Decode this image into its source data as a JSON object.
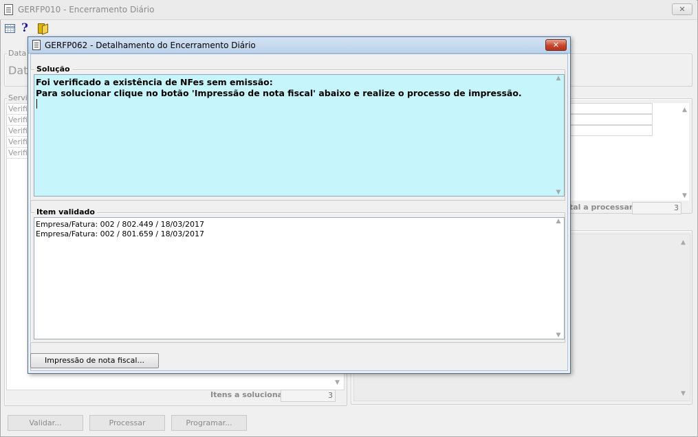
{
  "main_window": {
    "title": "GERFP010 - Encerramento Diário",
    "close_symbol": "✕",
    "toolbar": {
      "grid_icon": "grid-icon",
      "help_icon": "?",
      "exit_icon": "door-exit-icon"
    },
    "data_group": {
      "title": "Data",
      "big_label": "Data"
    },
    "servicos_group": {
      "title": "Servi",
      "rows": [
        "Verific",
        "Verific",
        "Verific",
        "Verific",
        "Verific"
      ]
    },
    "total_label": "tal a processar",
    "total_value": "3",
    "itens_solucionar_label": "Itens a solucionar",
    "itens_solucionar_value": "3",
    "buttons": {
      "validar": "Validar...",
      "processar": "Processar",
      "programar": "Programar..."
    }
  },
  "dialog": {
    "title": "GERFP062 - Detalhamento do Encerramento Diário",
    "close_symbol": "✕",
    "solucao": {
      "title": "Solução",
      "line1": "Foi verificado a existência de NFes sem emissão:",
      "line2": "Para solucionar clique no botão 'Impressão de nota fiscal' abaixo e realize o processo de impressão."
    },
    "item_validado": {
      "title": "Item validado",
      "lines": [
        "Empresa/Fatura: 002 / 802.449 / 18/03/2017",
        "Empresa/Fatura: 002 / 801.659 / 18/03/2017"
      ]
    },
    "print_button": "Impressão de nota fiscal...",
    "colors": {
      "solucao_bg": "#c6f5fb",
      "close_red": "#c9452c"
    }
  },
  "scroll": {
    "up": "▲",
    "down": "▼"
  }
}
